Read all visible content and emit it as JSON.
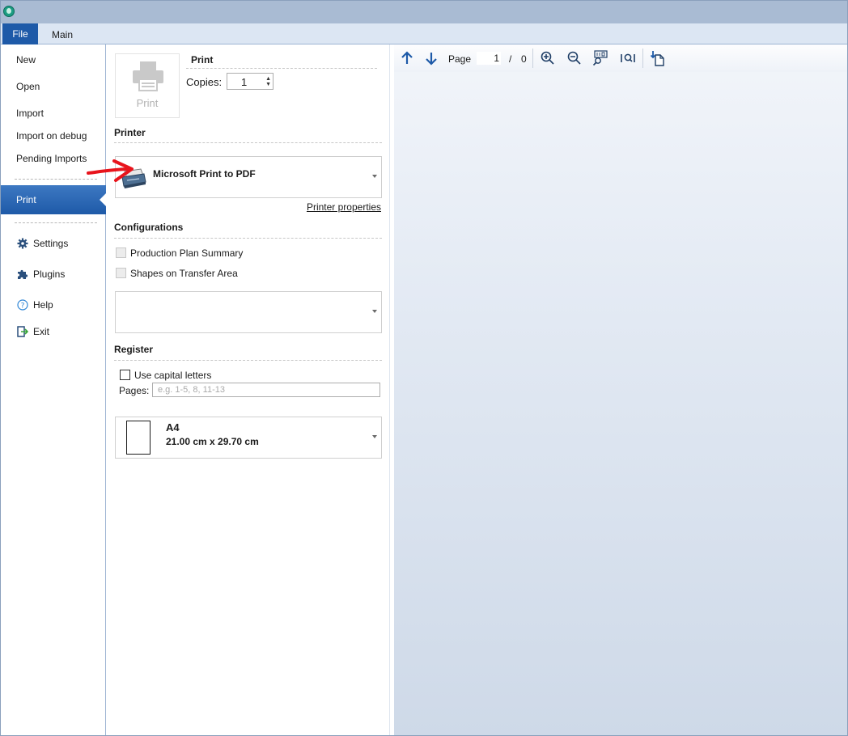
{
  "ribbon": {
    "tabs": [
      {
        "label": "File"
      },
      {
        "label": "Main"
      }
    ]
  },
  "nav": {
    "items": [
      {
        "label": "New"
      },
      {
        "label": "Open"
      },
      {
        "label": "Import"
      },
      {
        "label": "Import on debug"
      },
      {
        "label": "Pending Imports"
      },
      {
        "label": "Print"
      },
      {
        "label": "Settings",
        "icon": "gear-icon"
      },
      {
        "label": "Plugins",
        "icon": "puzzle-icon"
      },
      {
        "label": "Help",
        "icon": "help-icon"
      },
      {
        "label": "Exit",
        "icon": "exit-icon"
      }
    ]
  },
  "print": {
    "button_label": "Print",
    "heading": "Print",
    "copies_label": "Copies:",
    "copies_value": "1"
  },
  "printer": {
    "heading": "Printer",
    "selected": "Microsoft Print to PDF",
    "properties_link": "Printer properties"
  },
  "configurations": {
    "heading": "Configurations",
    "options": [
      {
        "label": "Production Plan Summary",
        "checked": false
      },
      {
        "label": "Shapes on Transfer Area",
        "checked": false
      }
    ],
    "dropdown_value": ""
  },
  "register": {
    "heading": "Register",
    "capital_label": "Use capital letters",
    "pages_label": "Pages:",
    "pages_placeholder": "e.g. 1-5, 8, 11-13"
  },
  "paper": {
    "name": "A4",
    "size": "21.00 cm x 29.70 cm"
  },
  "preview": {
    "page_label": "Page",
    "current_page": "1",
    "separator": "/",
    "total_pages": "0"
  },
  "colors": {
    "accent": "#1e5aa8",
    "annotation": "#e8141c"
  }
}
